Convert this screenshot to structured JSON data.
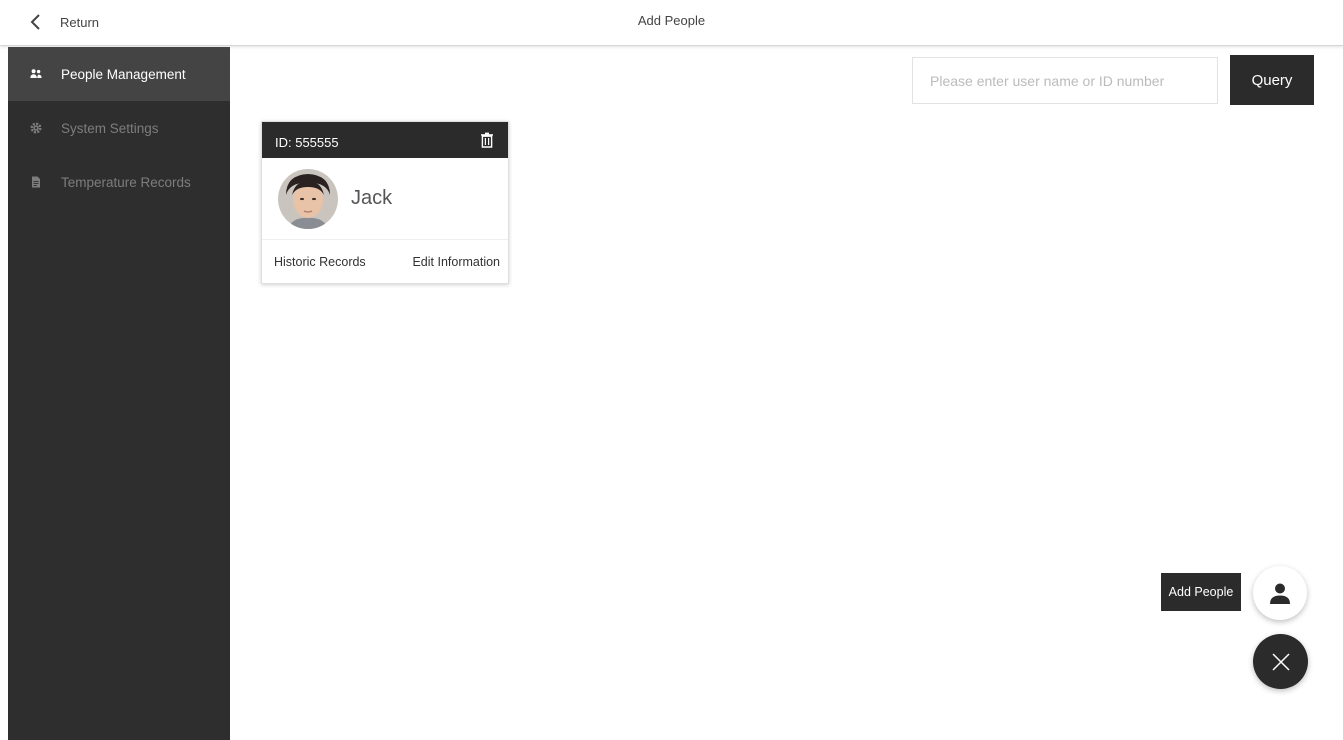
{
  "topbar": {
    "back_label": "Return",
    "title": "Add People"
  },
  "sidebar": {
    "items": [
      {
        "label": "People Management",
        "icon": "people-icon",
        "active": true
      },
      {
        "label": "System Settings",
        "icon": "gear-icon",
        "active": false
      },
      {
        "label": "Temperature Records",
        "icon": "document-icon",
        "active": false
      }
    ]
  },
  "search": {
    "placeholder": "Please enter user name or ID number",
    "value": "",
    "button_label": "Query"
  },
  "people": [
    {
      "id_text": "ID: 555555",
      "name": "Jack",
      "history_link": "Historic Records",
      "edit_link": "Edit Information"
    }
  ],
  "fab": {
    "add_label": "Add People",
    "add_icon": "person-icon",
    "close_icon": "close-icon"
  },
  "colors": {
    "sidebar_bg": "#2e2e2e",
    "sidebar_active": "#444444",
    "dark_accent": "#2b2b2b"
  }
}
